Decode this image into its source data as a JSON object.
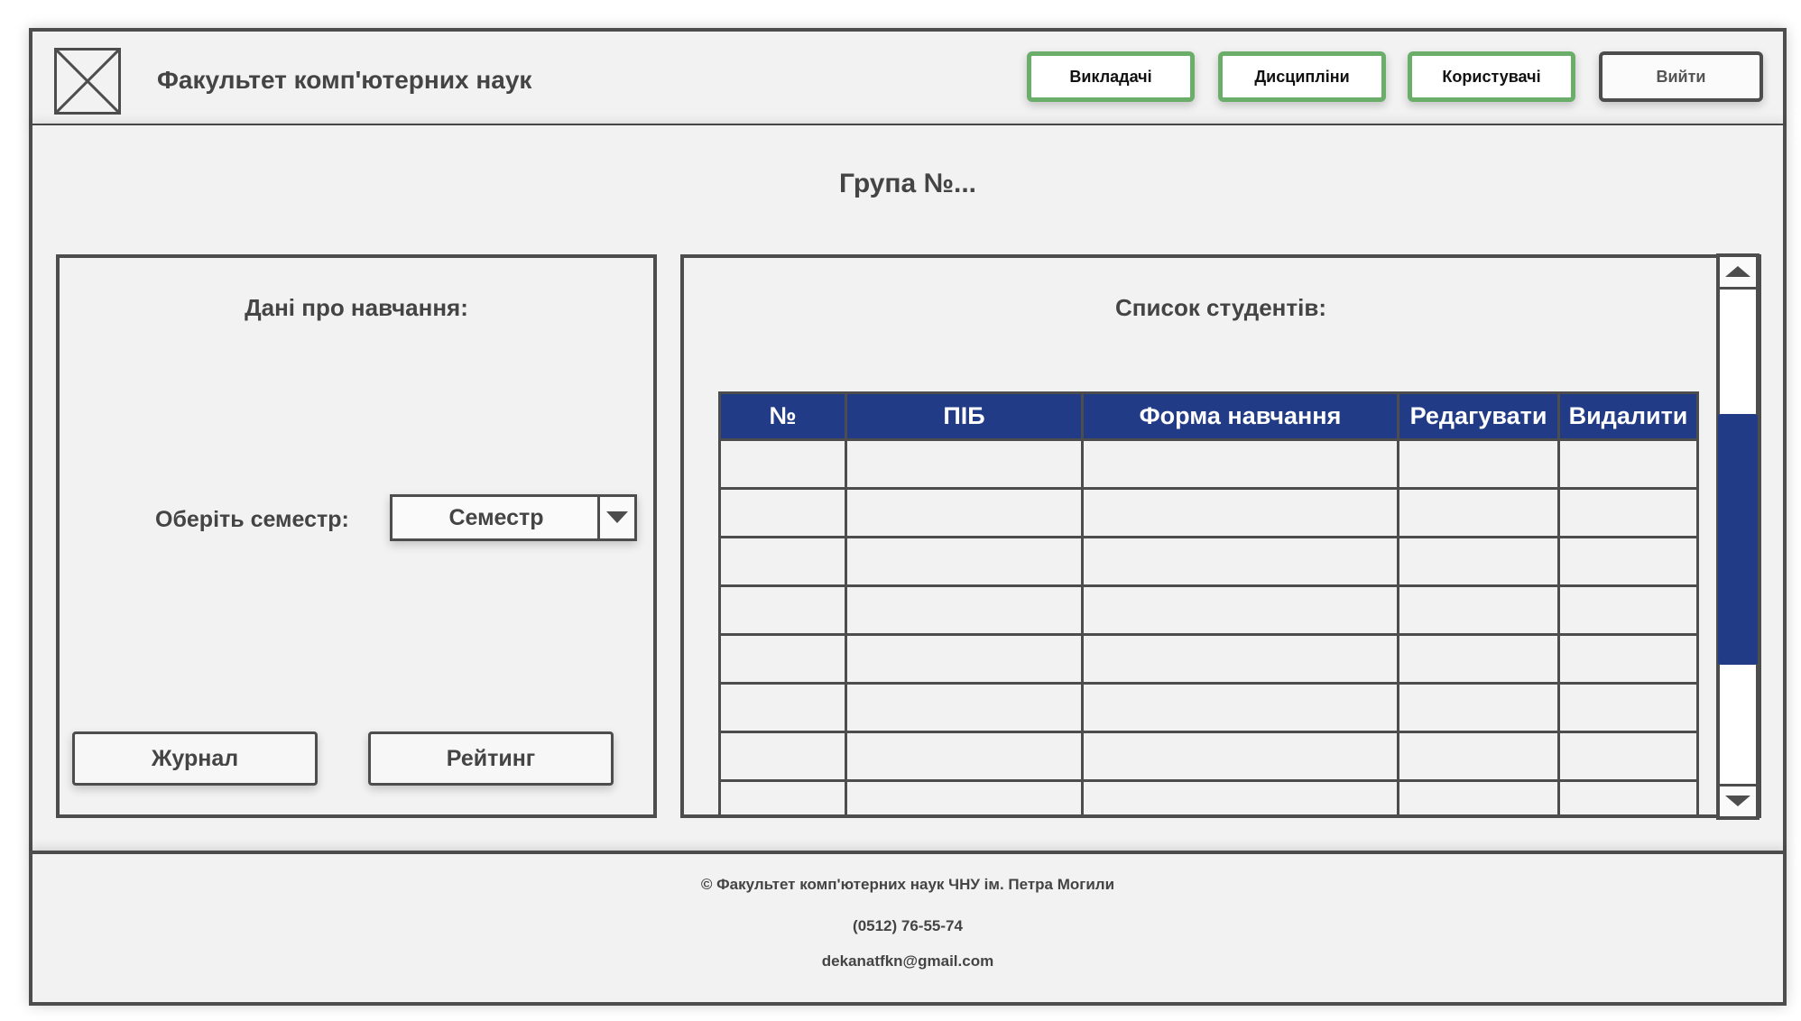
{
  "header": {
    "title": "Факультет комп'ютерних наук",
    "nav": [
      "Викладачі",
      "Дисципліни",
      "Користувачі"
    ],
    "logout_label": "Вийти"
  },
  "main": {
    "group_title": "Група №...",
    "study_panel": {
      "title": "Дані про навчання:",
      "semester_label": "Оберіть семестр:",
      "semester_value": "Семестр",
      "journal_label": "Журнал",
      "rating_label": "Рейтинг"
    },
    "students_panel": {
      "title": "Список студентів:",
      "columns": [
        "№",
        "ПІБ",
        "Форма навчання",
        "Редагувати",
        "Видалити"
      ]
    }
  },
  "footer": {
    "copyright": "© Факультет комп'ютерних наук ЧНУ ім. Петра Могили",
    "phone": "(0512) 76-55-74",
    "email": "dekanatfkn@gmail.com"
  },
  "colors": {
    "accent": "#213b86",
    "nav_border": "#6aae6a",
    "frame_border": "#4d4d4d",
    "background": "#f2f2f2"
  }
}
